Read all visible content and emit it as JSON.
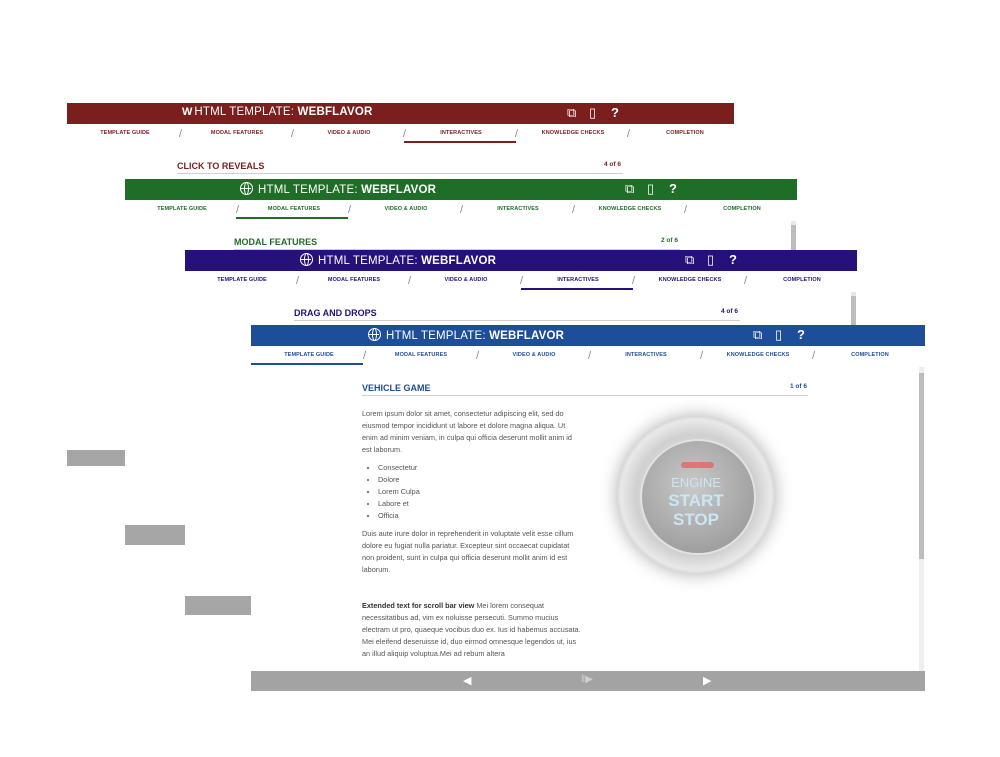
{
  "windows": [
    {
      "id": "w1",
      "theme": "#7a1e1e",
      "title_prefix": "HTML TEMPLATE:",
      "title_brand": "WEBFLAVOR",
      "logo": "wf-logo-icon",
      "nav": [
        "TEMPLATE GUIDE",
        "MODAL FEATURES",
        "VIDEO & AUDIO",
        "INTERACTIVES",
        "KNOWLEDGE CHECKS",
        "COMPLETION"
      ],
      "active_nav": 3,
      "heading": "CLICK TO REVEALS",
      "counter": "4 of 6"
    },
    {
      "id": "w2",
      "theme": "#1e6e28",
      "title_prefix": "HTML TEMPLATE:",
      "title_brand": "WEBFLAVOR",
      "logo": "globe-icon",
      "nav": [
        "TEMPLATE GUIDE",
        "MODAL FEATURES",
        "VIDEO & AUDIO",
        "INTERACTIVES",
        "KNOWLEDGE CHECKS",
        "COMPLETION"
      ],
      "active_nav": 1,
      "heading": "MODAL FEATURES",
      "counter": "2 of 6"
    },
    {
      "id": "w3",
      "theme": "#26107a",
      "title_prefix": "HTML TEMPLATE:",
      "title_brand": "WEBFLAVOR",
      "logo": "globe-icon",
      "nav": [
        "TEMPLATE GUIDE",
        "MODAL FEATURES",
        "VIDEO & AUDIO",
        "INTERACTIVES",
        "KNOWLEDGE CHECKS",
        "COMPLETION"
      ],
      "active_nav": 3,
      "heading": "DRAG AND DROPS",
      "counter": "4 of 6"
    },
    {
      "id": "w4",
      "theme": "#1e4e99",
      "title_prefix": "HTML TEMPLATE:",
      "title_brand": "WEBFLAVOR",
      "logo": "globe-icon",
      "nav": [
        "TEMPLATE GUIDE",
        "MODAL FEATURES",
        "VIDEO & AUDIO",
        "INTERACTIVES",
        "KNOWLEDGE CHECKS",
        "COMPLETION"
      ],
      "active_nav": 0,
      "heading": "VEHICLE GAME",
      "counter": "1 of 6"
    }
  ],
  "content": {
    "para1": "Lorem ipsum dolor sit amet, consectetur adipiscing elit, sed do eiusmod tempor incididunt ut labore et dolore magna aliqua. Ut enim ad minim veniam, in culpa qui officia deserunt mollit anim id est laborum.",
    "bullets": [
      "Consectetur",
      "Dolore",
      "Lorem Culpa",
      "Labore et",
      "Officia"
    ],
    "para2": "Duis aute irure dolor in reprehenderit in voluptate velit esse cillum dolore eu fugiat nulla pariatur. Excepteur sint occaecat cupidatat non proident, sunt in culpa qui officia deserunt mollit anim id est laborum.",
    "para3_bold": "Extended text for scroll bar view",
    "para3": " Mei lorem consequat necessitatibus ad, vim ex noluisse persecuti. Summo mucius electram ut pro, quaeque vocibus duo ex. Ius id habemus accusata. Mei eleifend deseruisse id, duo eirmod omnesque legendos ut, ius an illud aliquip voluptua.Mei ad rebum altera"
  },
  "engine_button": {
    "line1": "ENGINE",
    "line2": "START",
    "line3": "STOP"
  },
  "toolbar_icons": [
    "external-link-icon",
    "book-icon",
    "help-icon"
  ],
  "footer": {
    "prev": "◀",
    "pause": "‖▶",
    "next": "▶"
  }
}
